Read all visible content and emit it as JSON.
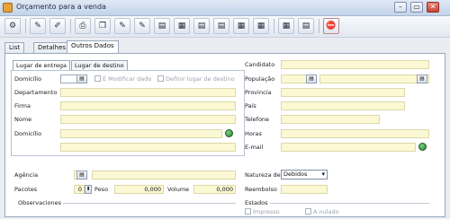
{
  "window": {
    "title": "Orçamento para a venda",
    "controls": {
      "minimize": "–",
      "restore": "▭",
      "close": "✕"
    }
  },
  "toolbar": {
    "icons": [
      "tool-icon",
      "pen-icon",
      "edit-icon",
      "print-icon",
      "copy-icon",
      "pen-icon",
      "pen-icon",
      "document-icon",
      "table-icon",
      "document-icon",
      "document-icon",
      "table-icon",
      "table-icon",
      "table-icon",
      "document-icon",
      "clipboard-stop-icon"
    ]
  },
  "tabs": [
    "List",
    "Detalhes",
    "Outros Dados"
  ],
  "subtabs": [
    "Lugar de entrega",
    "Lugar de destino"
  ],
  "left_fields": {
    "domicilio": "Domicílio",
    "e_modificar": "É Modificar dado",
    "definir": "Definir lugar de destino",
    "departamento": "Departamento",
    "firma": "Firma",
    "nome": "Nome",
    "domicilio2": "Domicílio"
  },
  "right_fields": {
    "candidato": "Candidato",
    "populacao": "População",
    "provincia": "Provincia",
    "pais": "País",
    "telefone": "Telefone",
    "horas": "Horas",
    "email": "E-mail"
  },
  "lower": {
    "agencia": "Agência",
    "pacotes": "Pacotes",
    "pacotes_value": "0",
    "peso": "Peso",
    "peso_value": "0,000",
    "volume": "Volume",
    "volume_value": "0,000",
    "natureza": "Natureza de",
    "natureza_value": "Debidos",
    "reembolso": "Reembolso",
    "observacoes": "Observaciones",
    "estados": "Estados",
    "impresso": "Impresso",
    "anulado": "A nulado"
  }
}
